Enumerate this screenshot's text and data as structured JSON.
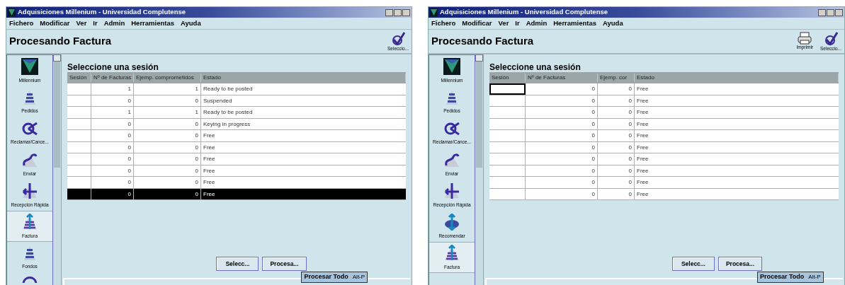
{
  "windows": [
    {
      "title": "Adquisiciones Millenium - Universidad Complutense",
      "menu": [
        "Fichero",
        "Modificar",
        "Ver",
        "Ir",
        "Admin",
        "Herramientas",
        "Ayuda"
      ],
      "heading": "Procesando Factura",
      "toolbar": [
        {
          "kind": "check",
          "label": "Seleccio..."
        }
      ],
      "sidebar": [
        {
          "kind": "millennium",
          "label": "Millennium",
          "selected": false
        },
        {
          "kind": "stack",
          "label": "Pedidos",
          "selected": false
        },
        {
          "kind": "claim",
          "label": "Reclamar/Cance...",
          "selected": false
        },
        {
          "kind": "send",
          "label": "Enviar",
          "selected": false
        },
        {
          "kind": "receive",
          "label": "Recepción Rápida",
          "selected": false
        },
        {
          "kind": "invoice",
          "label": "Factura",
          "selected": true
        },
        {
          "kind": "stack",
          "label": "Fondos",
          "selected": false
        },
        {
          "kind": "globe",
          "selected": false
        }
      ],
      "section_title": "Seleccione una sesión",
      "columns": [
        "Sesión",
        "Nº de Facturas",
        "Ejemp. comprometidos",
        "Estado"
      ],
      "rows": [
        {
          "facturas": "1",
          "ejemplares": "1",
          "estado": "Ready to be posted",
          "selected": false,
          "focused": false
        },
        {
          "facturas": "0",
          "ejemplares": "0",
          "estado": "Suspended",
          "selected": false,
          "focused": false
        },
        {
          "facturas": "1",
          "ejemplares": "1",
          "estado": "Ready to be posted",
          "selected": false,
          "focused": false
        },
        {
          "facturas": "0",
          "ejemplares": "0",
          "estado": "Keying in progress",
          "selected": false,
          "focused": false
        },
        {
          "facturas": "0",
          "ejemplares": "0",
          "estado": "Free",
          "selected": false,
          "focused": false
        },
        {
          "facturas": "0",
          "ejemplares": "0",
          "estado": "Free",
          "selected": false,
          "focused": false
        },
        {
          "facturas": "0",
          "ejemplares": "0",
          "estado": "Free",
          "selected": false,
          "focused": false
        },
        {
          "facturas": "0",
          "ejemplares": "0",
          "estado": "Free",
          "selected": false,
          "focused": false
        },
        {
          "facturas": "0",
          "ejemplares": "0",
          "estado": "Free",
          "selected": false,
          "focused": false
        },
        {
          "facturas": "0",
          "ejemplares": "0",
          "estado": "Free",
          "selected": true,
          "focused": false
        }
      ],
      "buttons": [
        "Selecc...",
        "Procesa..."
      ],
      "tooltip": {
        "label": "Procesar Todo",
        "shortcut": "Alt-P"
      }
    },
    {
      "title": "Adquisiciones Millenium - Universidad Complutense",
      "menu": [
        "Fichero",
        "Modificar",
        "Ver",
        "Ir",
        "Admin",
        "Herramientas",
        "Ayuda"
      ],
      "heading": "Procesando Factura",
      "toolbar": [
        {
          "kind": "printer",
          "label": "Imprimir"
        },
        {
          "kind": "check",
          "label": "Seleccio..."
        }
      ],
      "sidebar": [
        {
          "kind": "millennium",
          "label": "Millennium",
          "selected": false
        },
        {
          "kind": "stack",
          "label": "Pedidos",
          "selected": false
        },
        {
          "kind": "claim",
          "label": "Reclamar/Cance...",
          "selected": false
        },
        {
          "kind": "send",
          "label": "Enviar",
          "selected": false
        },
        {
          "kind": "receive",
          "label": "Recepción Rápida",
          "selected": false
        },
        {
          "kind": "recommend",
          "label": "Recomendar",
          "selected": false
        },
        {
          "kind": "invoice",
          "label": "Factura",
          "selected": true
        }
      ],
      "section_title": "Seleccione una sesión",
      "columns": [
        "Sesión",
        "Nº de Facturas",
        "Ejemp. cor",
        "Estado"
      ],
      "rows": [
        {
          "facturas": "0",
          "ejemplares": "0",
          "estado": "Free",
          "selected": false,
          "focused": true
        },
        {
          "facturas": "0",
          "ejemplares": "0",
          "estado": "Free",
          "selected": false,
          "focused": false
        },
        {
          "facturas": "0",
          "ejemplares": "0",
          "estado": "Free",
          "selected": false,
          "focused": false
        },
        {
          "facturas": "0",
          "ejemplares": "0",
          "estado": "Free",
          "selected": false,
          "focused": false
        },
        {
          "facturas": "0",
          "ejemplares": "0",
          "estado": "Free",
          "selected": false,
          "focused": false
        },
        {
          "facturas": "0",
          "ejemplares": "0",
          "estado": "Free",
          "selected": false,
          "focused": false
        },
        {
          "facturas": "0",
          "ejemplares": "0",
          "estado": "Free",
          "selected": false,
          "focused": false
        },
        {
          "facturas": "0",
          "ejemplares": "0",
          "estado": "Free",
          "selected": false,
          "focused": false
        },
        {
          "facturas": "0",
          "ejemplares": "0",
          "estado": "Free",
          "selected": false,
          "focused": false
        },
        {
          "facturas": "0",
          "ejemplares": "0",
          "estado": "Free",
          "selected": false,
          "focused": false
        }
      ],
      "buttons": [
        "Selecc...",
        "Procesa..."
      ],
      "tooltip": {
        "label": "Procesar Todo",
        "shortcut": "Alt-P"
      }
    }
  ]
}
